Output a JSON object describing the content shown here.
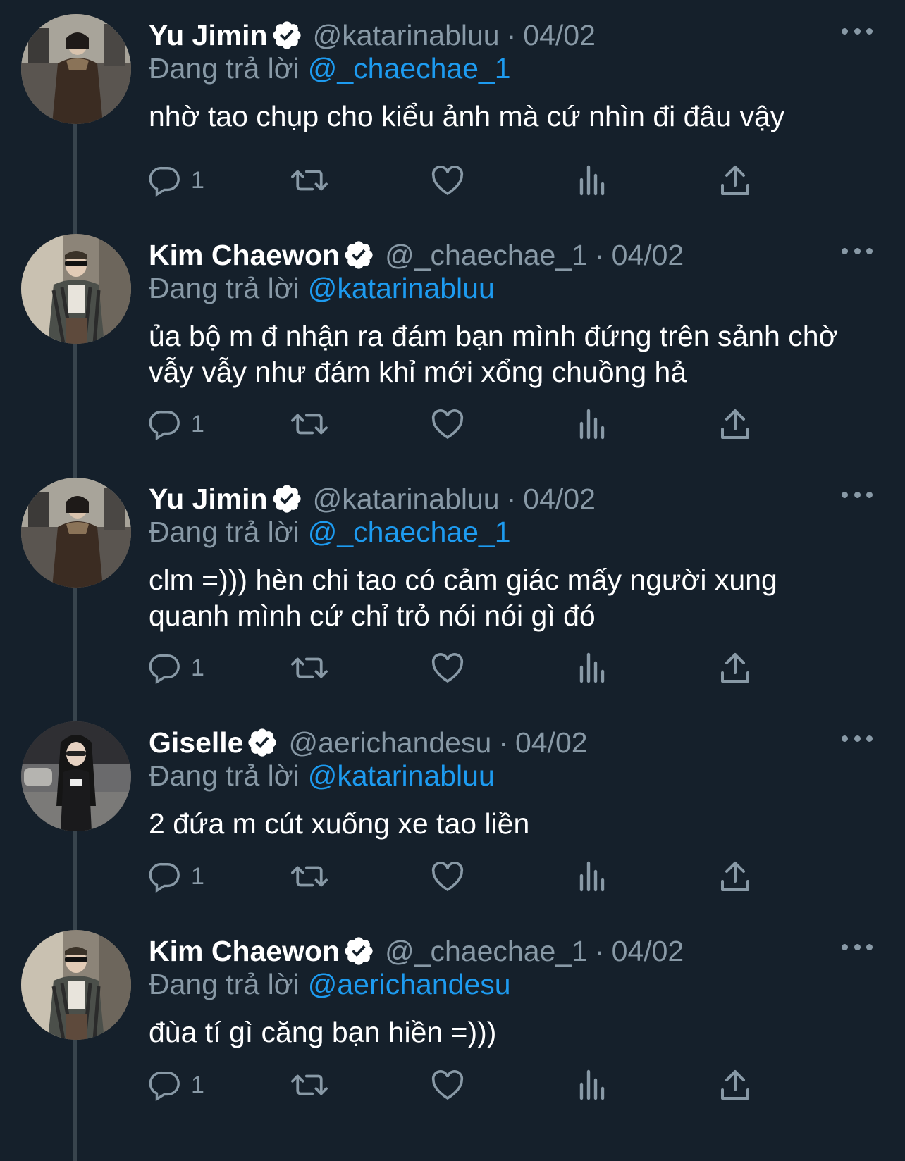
{
  "tweets": [
    {
      "name": "Yu Jimin",
      "handle": "@katarinabluu",
      "date": "04/02",
      "reply_label": "Đang trả lời",
      "reply_to": "@_chaechae_1",
      "text": "nhờ tao chụp cho kiểu ảnh mà cứ nhìn đi đâu vậy",
      "reply_count": "1"
    },
    {
      "name": "Kim Chaewon",
      "handle": "@_chaechae_1",
      "date": "04/02",
      "reply_label": "Đang trả lời",
      "reply_to": "@katarinabluu",
      "text": "ủa bộ m đ nhận ra đám bạn mình đứng trên sảnh chờ vẫy vẫy như đám khỉ mới xổng chuồng hả",
      "reply_count": "1"
    },
    {
      "name": "Yu Jimin",
      "handle": "@katarinabluu",
      "date": "04/02",
      "reply_label": "Đang trả lời",
      "reply_to": "@_chaechae_1",
      "text": "clm =))) hèn chi tao có cảm giác mấy người xung quanh mình cứ chỉ trỏ nói nói gì đó",
      "reply_count": "1"
    },
    {
      "name": "Giselle",
      "handle": "@aerichandesu",
      "date": "04/02",
      "reply_label": "Đang trả lời",
      "reply_to": "@katarinabluu",
      "text": "2 đứa m cút xuống xe tao liền",
      "reply_count": "1"
    },
    {
      "name": "Kim Chaewon",
      "handle": "@_chaechae_1",
      "date": "04/02",
      "reply_label": "Đang trả lời",
      "reply_to": "@aerichandesu",
      "text": "đùa tí gì căng bạn hiền =)))",
      "reply_count": "1"
    }
  ],
  "colors": {
    "background": "#15202b",
    "primary_text": "#ffffff",
    "secondary_text": "#8899a6",
    "link": "#1d9bf0",
    "thread_line": "#38444d"
  },
  "icons": {
    "verified": "verified-badge-icon",
    "more": "more-options-icon",
    "reply": "reply-icon",
    "retweet": "retweet-icon",
    "like": "like-icon",
    "views": "views-icon",
    "share": "share-icon"
  }
}
